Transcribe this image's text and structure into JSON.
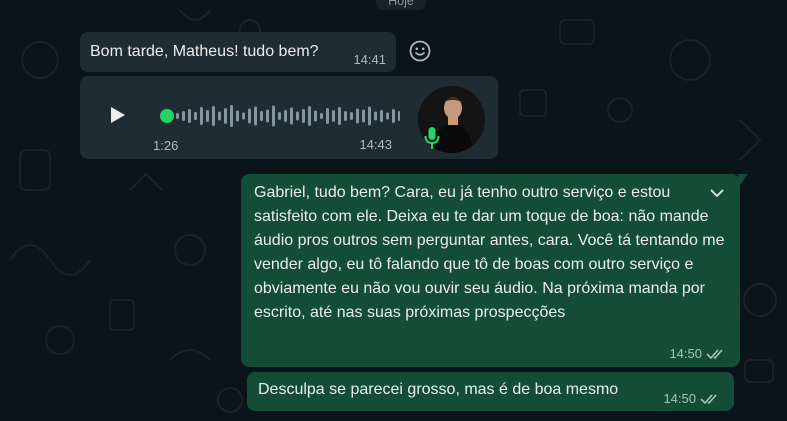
{
  "date_divider": "Hoje",
  "messages": [
    {
      "type": "incoming_text",
      "text": "Bom tarde, Matheus! tudo bem?",
      "time": "14:41"
    },
    {
      "type": "incoming_audio",
      "duration": "1:26",
      "time": "14:43",
      "progress": 0.0
    },
    {
      "type": "outgoing_text",
      "text": "Gabriel, tudo bem? Cara, eu já tenho outro serviço e estou satisfeito com ele. Deixa eu te dar um toque de boa: não mande áudio pros outros sem perguntar antes, cara. Você tá tentando me vender algo, eu tô falando que tô de boas com outro serviço e obviamente eu não vou ouvir seu áudio. Na próxima manda por escrito, até nas suas próximas prospecções",
      "time": "14:50",
      "status": "read"
    },
    {
      "type": "outgoing_text",
      "text": "Desculpa se parecei grosso, mas é de boa mesmo",
      "time": "14:50",
      "status": "read"
    }
  ],
  "icons": {
    "react": "smile-icon",
    "play": "play-icon",
    "mic": "mic-icon",
    "menu": "chevron-down-icon",
    "read": "double-check-icon"
  },
  "colors": {
    "background": "#0b141a",
    "incoming_bubble": "#202c33",
    "outgoing_bubble": "#134d37",
    "accent_green": "#25d366"
  }
}
